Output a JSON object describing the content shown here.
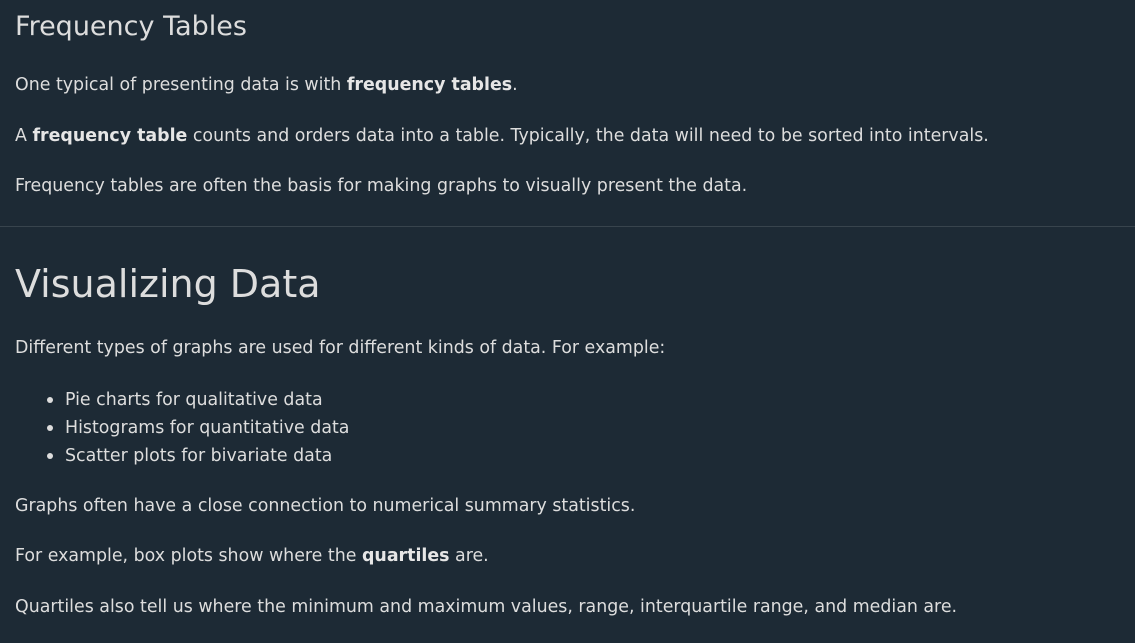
{
  "frequency_section": {
    "title": "Frequency Tables",
    "p1": {
      "before": "One typical of presenting data is with ",
      "bold": "frequency tables",
      "after": "."
    },
    "p2": {
      "before": "A ",
      "bold": "frequency table",
      "after": " counts and orders data into a table. Typically, the data will need to be sorted into intervals."
    },
    "p3": "Frequency tables are often the basis for making graphs to visually present the data."
  },
  "visualizing_section": {
    "title": "Visualizing Data",
    "intro": "Different types of graphs are used for different kinds of data. For example:",
    "list": [
      "Pie charts for qualitative data",
      "Histograms for quantitative data",
      "Scatter plots for bivariate data"
    ],
    "p_summary": "Graphs often have a close connection to numerical summary statistics.",
    "p_boxplot": {
      "before": "For example, box plots show where the ",
      "bold": "quartiles",
      "after": " are."
    },
    "p_quartiles": "Quartiles also tell us where the minimum and maximum values, range, interquartile range, and median are."
  }
}
